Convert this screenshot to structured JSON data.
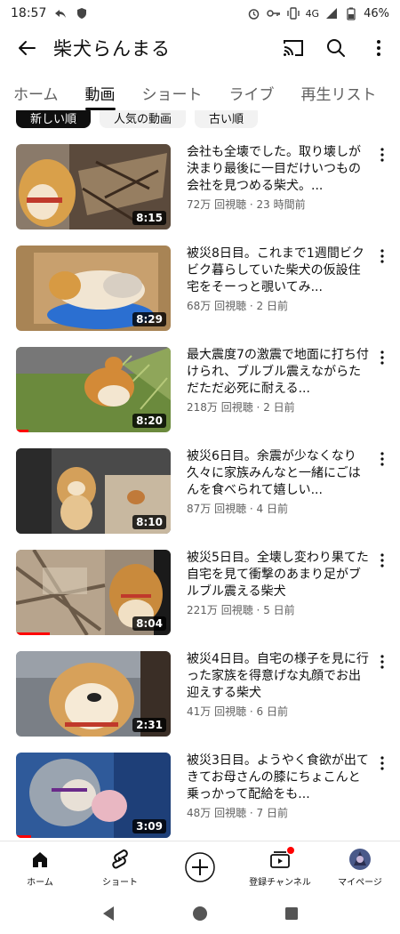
{
  "status": {
    "time": "18:57",
    "network": "4G",
    "battery": "46%"
  },
  "header": {
    "title": "柴犬らんまる"
  },
  "tabs": [
    {
      "label": "ホーム"
    },
    {
      "label": "動画"
    },
    {
      "label": "ショート"
    },
    {
      "label": "ライブ"
    },
    {
      "label": "再生リスト"
    }
  ],
  "chips": [
    {
      "label": "新しい順"
    },
    {
      "label": "人気の動画"
    },
    {
      "label": "古い順"
    }
  ],
  "videos": [
    {
      "title": "会社も全壊でした。取り壊しが決まり最後に一目だけいつもの会社を見つめる柴犬。...",
      "views": "72万 回視聴",
      "age": "23 時間前",
      "duration": "8:15",
      "progress": 0
    },
    {
      "title": "被災8日目。これまで1週間ビクビク暮らしていた柴犬の仮設住宅をそーっと覗いてみ...",
      "views": "68万 回視聴",
      "age": "2 日前",
      "duration": "8:29",
      "progress": 0
    },
    {
      "title": "最大震度7の激震で地面に打ち付けられ、ブルブル震えながらただただ必死に耐える...",
      "views": "218万 回視聴",
      "age": "2 日前",
      "duration": "8:20",
      "progress": 0.08
    },
    {
      "title": "被災6日目。余震が少なくなり久々に家族みんなと一緒にごはんを食べられて嬉しい...",
      "views": "87万 回視聴",
      "age": "4 日前",
      "duration": "8:10",
      "progress": 0
    },
    {
      "title": "被災5日目。全壊し変わり果てた自宅を見て衝撃のあまり足がブルブル震える柴犬",
      "views": "221万 回視聴",
      "age": "5 日前",
      "duration": "8:04",
      "progress": 0.22
    },
    {
      "title": "被災4日目。自宅の様子を見に行った家族を得意げな丸顔でお出迎えする柴犬",
      "views": "41万 回視聴",
      "age": "6 日前",
      "duration": "2:31",
      "progress": 0
    },
    {
      "title": "被災3日目。ようやく食欲が出てきてお母さんの膝にちょこんと乗っかって配給をも...",
      "views": "48万 回視聴",
      "age": "7 日前",
      "duration": "3:09",
      "progress": 0.1
    }
  ],
  "bottom_nav": [
    {
      "label": "ホーム",
      "icon": "home-icon"
    },
    {
      "label": "ショート",
      "icon": "shorts-icon"
    },
    {
      "label": "",
      "icon": "create-icon"
    },
    {
      "label": "登録チャンネル",
      "icon": "subscriptions-icon"
    },
    {
      "label": "マイページ",
      "icon": "avatar-icon"
    }
  ],
  "colors": {
    "accent": "#ff0000",
    "text": "#0f0f0f",
    "secondary_text": "#606060"
  }
}
